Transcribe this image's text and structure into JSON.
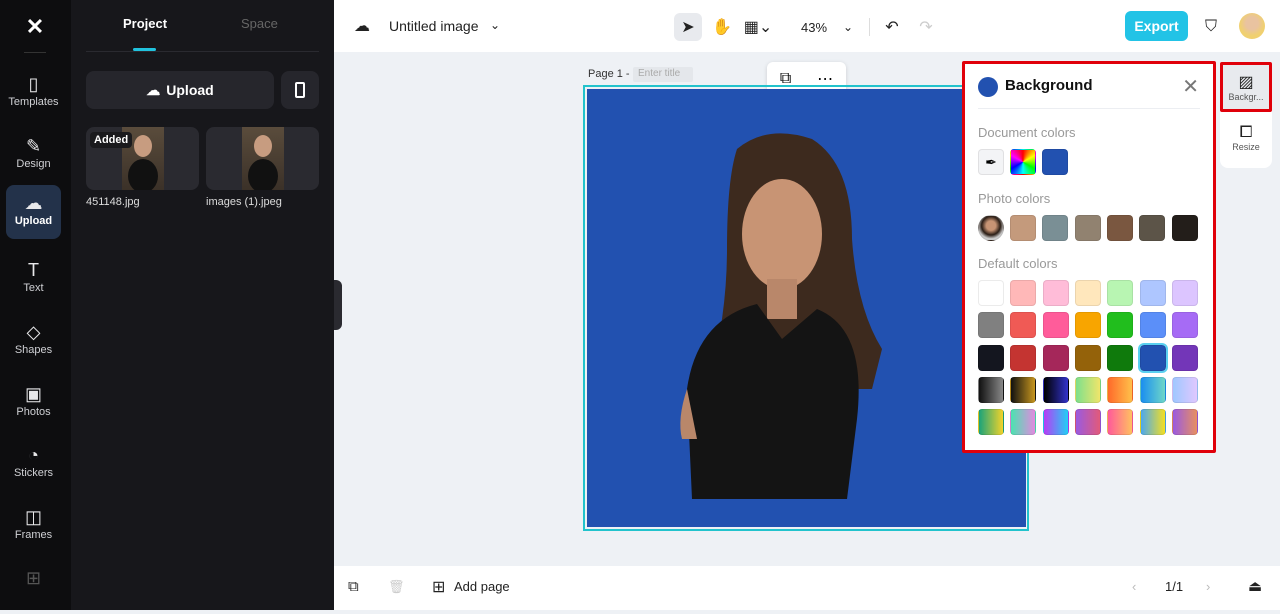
{
  "rail": {
    "items": [
      {
        "label": "Templates",
        "icon": "templates-icon"
      },
      {
        "label": "Design",
        "icon": "design-icon"
      },
      {
        "label": "Upload",
        "icon": "upload-icon"
      },
      {
        "label": "Text",
        "icon": "text-icon"
      },
      {
        "label": "Shapes",
        "icon": "shapes-icon"
      },
      {
        "label": "Photos",
        "icon": "photos-icon"
      },
      {
        "label": "Stickers",
        "icon": "stickers-icon"
      },
      {
        "label": "Frames",
        "icon": "frames-icon"
      }
    ]
  },
  "panel": {
    "tabs": [
      "Project",
      "Space"
    ],
    "upload_label": "Upload",
    "files": [
      {
        "name": "451148.jpg",
        "badge": "Added"
      },
      {
        "name": "images (1).jpeg"
      }
    ]
  },
  "header": {
    "title": "Untitled image",
    "zoom": "43%",
    "export": "Export"
  },
  "canvas": {
    "page_label": "Page 1 -",
    "title_placeholder": "Enter title",
    "bg_color": "#2251b0"
  },
  "background_panel": {
    "title": "Background",
    "document_label": "Document colors",
    "document_colors": [
      "#2251b0"
    ],
    "photo_label": "Photo colors",
    "photo_colors": [
      "#c49a7c",
      "#7a8f95",
      "#918270",
      "#7a5740",
      "#5c5448",
      "#231e1a"
    ],
    "default_label": "Default colors",
    "default_colors": [
      "#ffffff",
      "#ffb8b8",
      "#ffbcd8",
      "#ffe7bc",
      "#b8f5b2",
      "#aec6ff",
      "#dcc5ff",
      "#808080",
      "#f05a55",
      "#ff5c9a",
      "#f8a500",
      "#21be1d",
      "#5b8ff9",
      "#a66bf5",
      "#14161f",
      "#c43431",
      "#a5275a",
      "#94620a",
      "#0f7a0c",
      "#2251b0",
      "#7336b8"
    ],
    "gradients": [
      "linear-gradient(90deg,#111,#888)",
      "linear-gradient(90deg,#111,#c8961e)",
      "linear-gradient(90deg,#000,#3333cc)",
      "linear-gradient(90deg,#7ee08c,#f0e56a)",
      "linear-gradient(90deg,#ff6a2a,#ffc04a)",
      "linear-gradient(90deg,#1a8ef0,#6fd7c8)",
      "linear-gradient(90deg,#9fc8ff,#e0c8ff)",
      "linear-gradient(90deg,#1aa37a,#f2d32a)",
      "linear-gradient(90deg,#4ae3b0,#e28ae0)",
      "linear-gradient(90deg,#b83cf5,#20d0f5)",
      "linear-gradient(90deg,#9a5ae0,#e25a7a)",
      "linear-gradient(90deg,#ff5a9a,#ffc060)",
      "linear-gradient(90deg,#4aa8f0,#f5e020)",
      "linear-gradient(90deg,#9a5ae0,#e89060)"
    ],
    "selected": "#2251b0"
  },
  "side_tools": [
    {
      "label": "Backgr...",
      "icon": "background-icon"
    },
    {
      "label": "Resize",
      "icon": "resize-icon"
    }
  ],
  "footer": {
    "add_page": "Add page",
    "page_count": "1/1"
  }
}
